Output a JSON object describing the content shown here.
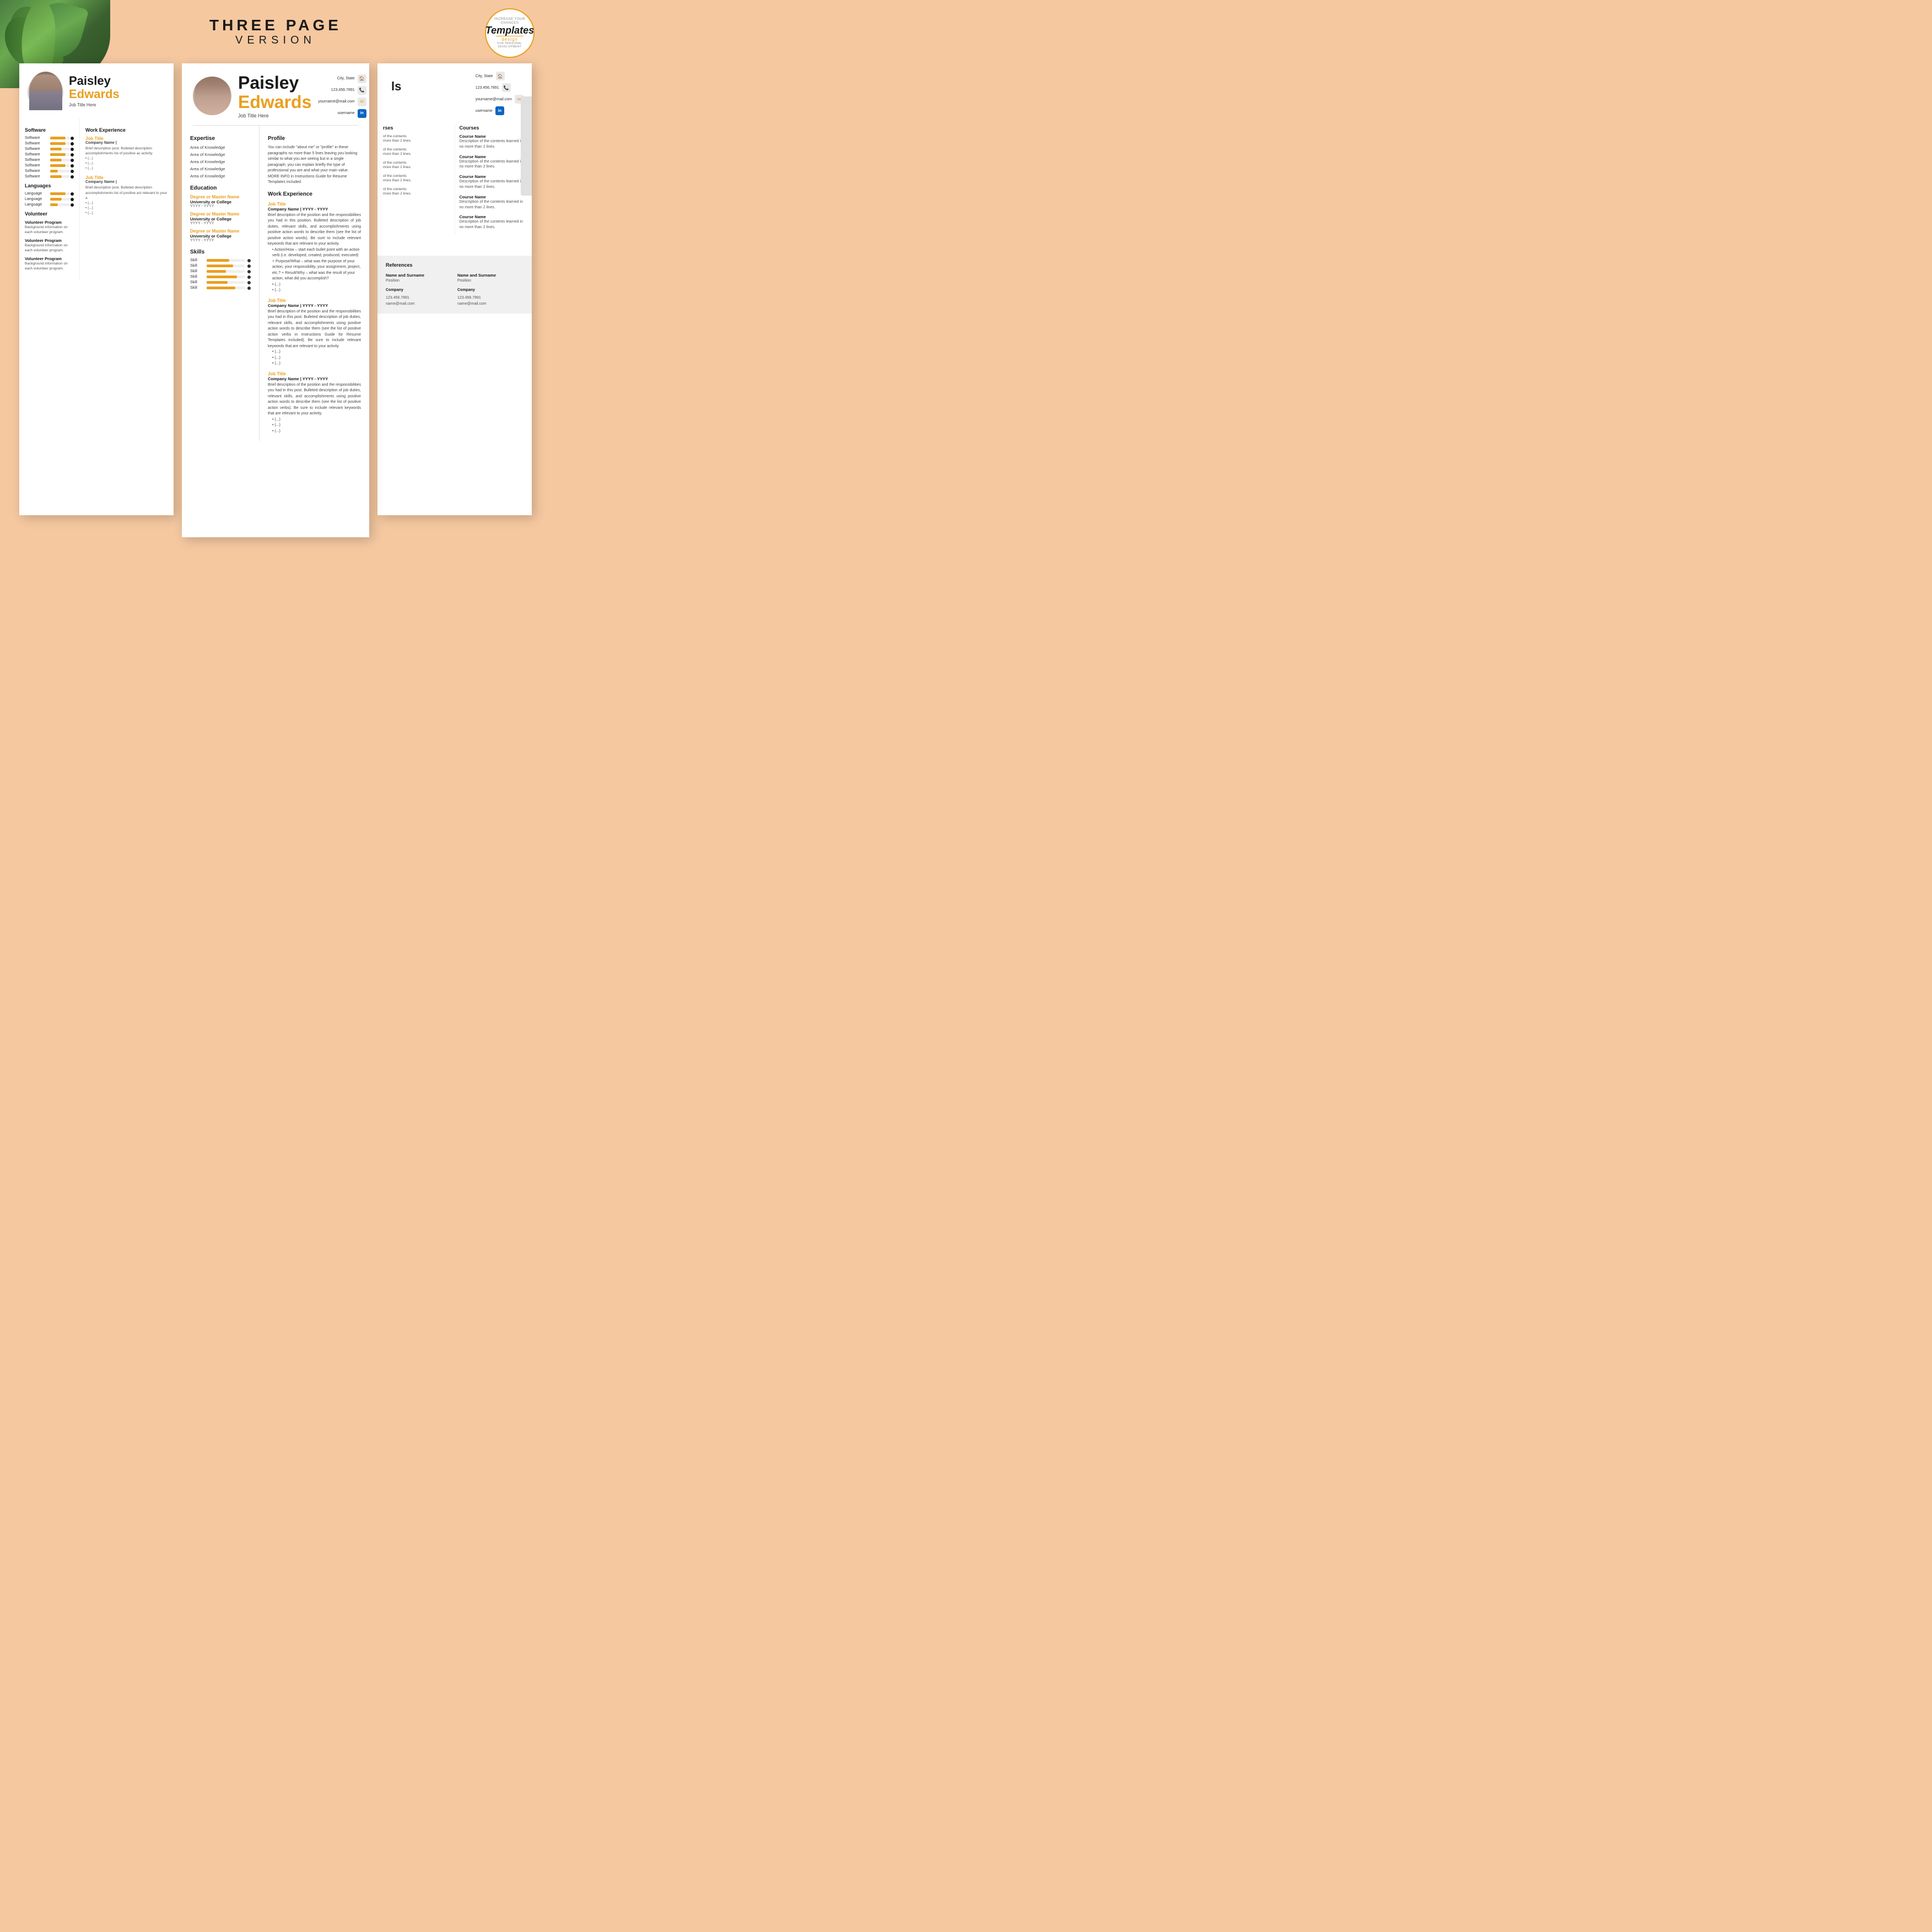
{
  "header": {
    "title": "THREE PAGE",
    "subtitle": "VERSION"
  },
  "logo": {
    "text": "Templates",
    "design": "design",
    "tagline": "INCREASE YOUR CHANCES"
  },
  "page_center": {
    "first_name": "Paisley",
    "last_name": "Edwards",
    "job_title": "Job Title Here",
    "contact": {
      "city_state": "City, State",
      "phone": "123.456.7891",
      "email": "yourname@mail.com",
      "linkedin": "username"
    },
    "expertise": {
      "title": "Expertise",
      "items": [
        "Area of Knowledge",
        "Area of Knowledge",
        "Area of Knowledge",
        "Area of Knowledge",
        "Area of Knowledge"
      ]
    },
    "education": {
      "title": "Education",
      "degrees": [
        {
          "name": "Degree or Master Name",
          "school": "University or College",
          "years": "YYYY - YYYY"
        },
        {
          "name": "Degree or Master Name",
          "school": "University or College",
          "years": "YYYY - YYYY"
        },
        {
          "name": "Degree or Master Name",
          "school": "University or College",
          "years": "YYYY - YYYY"
        }
      ]
    },
    "skills": {
      "title": "Skills",
      "items": [
        {
          "name": "Skill",
          "level": 60
        },
        {
          "name": "Skill",
          "level": 70
        },
        {
          "name": "Skill",
          "level": 50
        },
        {
          "name": "Skill",
          "level": 80
        },
        {
          "name": "Skill",
          "level": 55
        },
        {
          "name": "Skill",
          "level": 75
        }
      ]
    },
    "profile": {
      "title": "Profile",
      "text": "You can include \"about me\" or \"profile\" in these paragraphs no more than 5 lines leaving you looking similar to what you are seeing but in a single paragraph, you can explain briefly the type of professional you are and what your main value. MORE INFO in Instructions Guide for Resume Templates included."
    },
    "work_experience": {
      "title": "Work Experience",
      "jobs": [
        {
          "title": "Job Title",
          "company": "Company Name | YYYY - YYYY",
          "description": "Brief description of the position and the responsibilities you had in this position. Bulleted description of job duties, relevant skills, and accomplishments using positive action words to describe them (see the list of positive action words). Be sure to include relevant keywords that are relevant to your activity.",
          "bullets": [
            "Action/How – start each bullet point with an action verb (i.e. developed, created, produced, executed) + Purpose/What – what was the purpose of your action, your responsibility, your assignment, project, etc.? + Result/Why – what was the result of your action, what did you accomplish?",
            "(...)",
            "(...)"
          ]
        },
        {
          "title": "Job Title",
          "company": "Company Name | YYYY - YYYY",
          "description": "Brief description of the position and the responsibilities you had in this post. Bulleted description of job duties, relevant skills, and accomplishments using positive action words to describe them (see the list of positive action verbs in Instructions Guide for Resume Templates included). Be sure to include relevant keywords that are relevant to your activity.",
          "bullets": [
            "(...)",
            "(...)",
            "(...)"
          ]
        },
        {
          "title": "Job Title",
          "company": "Company Name | YYYY - YYYY",
          "description": "Brief description of the position and the responsibilities you had in this post. Bulleted description of job duties, relevant skills, and accomplishments using positive action words to describe them (see the list of positive action verbs). Be sure to include relevant keywords that are relevant to your activity.",
          "bullets": [
            "(...)",
            "(...)",
            "(...)"
          ]
        }
      ]
    }
  },
  "page_left": {
    "first_name": "Paisley",
    "last_name": "Edwards",
    "job_title": "Job Title Here",
    "software": {
      "title": "Software",
      "items": [
        {
          "name": "Software",
          "level": 4
        },
        {
          "name": "Software",
          "level": 4
        },
        {
          "name": "Software",
          "level": 3
        },
        {
          "name": "Software",
          "level": 4
        },
        {
          "name": "Software",
          "level": 3
        },
        {
          "name": "Software",
          "level": 4
        },
        {
          "name": "Software",
          "level": 2
        },
        {
          "name": "Software",
          "level": 3
        }
      ]
    },
    "languages": {
      "title": "Languages",
      "items": [
        {
          "name": "Language",
          "level": 4
        },
        {
          "name": "Language",
          "level": 3
        },
        {
          "name": "Language",
          "level": 2
        }
      ]
    },
    "volunteer": {
      "title": "Volunteer",
      "items": [
        {
          "title": "Volunteer Program",
          "desc": "Background information on each volunteer program."
        },
        {
          "title": "Volunteer Program",
          "desc": "Background information on each volunteer program."
        },
        {
          "title": "Volunteer Program",
          "desc": "Background information on each volunteer program."
        }
      ]
    },
    "work_experience": {
      "title": "Work Experience",
      "jobs": [
        {
          "title": "Job Title",
          "company": "Company Name |",
          "description": "Brief description post. Bulleted description accomplishments list of positive ac activity.",
          "bullets": [
            "(...)",
            "(...)",
            "(...)"
          ]
        },
        {
          "title": "Job Title",
          "company": "Company Name |",
          "description": "Brief description post. Bulleted description accomplishments list of positive act relevant to your a",
          "bullets": [
            "(...)",
            "(...)",
            "(...)"
          ]
        }
      ]
    }
  },
  "page_right": {
    "contact": {
      "city_state": "City, State",
      "phone": "123.456.7891",
      "email": "yourname@mail.com",
      "linkedin": "username"
    },
    "courses": {
      "title": "Courses",
      "items": [
        {
          "name": "Course Name",
          "desc": "Description of the contents learned in no more than 2 lines."
        },
        {
          "name": "Course Name",
          "desc": "Description of the contents learned in no more than 2 lines."
        },
        {
          "name": "Course Name",
          "desc": "Description of the contents learned in no more than 2 lines."
        },
        {
          "name": "Course Name",
          "desc": "Description of the contents learned in no more than 2 lines."
        },
        {
          "name": "Course Name",
          "desc": "Description of the contents learned in no more than 2 lines."
        }
      ]
    },
    "left_courses": [
      {
        "prefix": "of the contents",
        "suffix": "more than 2 lines."
      },
      {
        "prefix": "of the contents",
        "suffix": "more than 2 lines."
      },
      {
        "prefix": "of the contents",
        "suffix": "more than 2 lines."
      },
      {
        "prefix": "of the contents",
        "suffix": "more than 2 lines."
      },
      {
        "prefix": "of the contents",
        "suffix": "more than 2 lines."
      }
    ],
    "references": {
      "title": "References",
      "items": [
        {
          "name": "Name and Surname",
          "position": "Position",
          "company": "Company",
          "phone": "123.456.7891",
          "email": "name@mail.com"
        },
        {
          "name": "Name and Surname",
          "position": "Position",
          "company": "Company",
          "phone": "123.456.7891",
          "email": "name@mail.com"
        }
      ]
    }
  }
}
